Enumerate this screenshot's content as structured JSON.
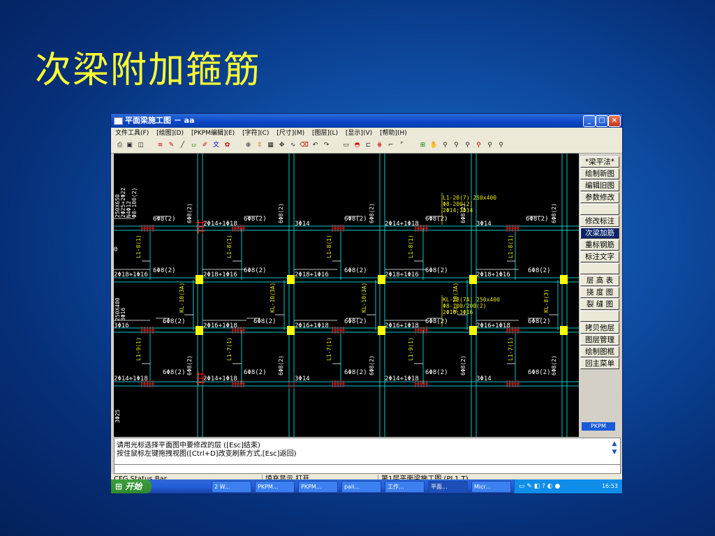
{
  "slide_title": "次梁附加箍筋",
  "window": {
    "title": "平面梁施工图 － aa",
    "min_label": "_",
    "max_label": "□",
    "close_label": "×"
  },
  "menu": [
    "文件工具(F)",
    "[绘图](D)",
    "[PKPM编辑](E)",
    "[字符](C)",
    "[尺寸](M)",
    "[图层](L)",
    "[显示](V)",
    "[帮助](H)"
  ],
  "side_menu": {
    "items": [
      "*梁平法*",
      "绘制新图",
      "编辑旧图",
      "参数修改",
      "",
      "修改标注",
      "次梁加筋",
      "重标钢筋",
      "标注文字",
      "",
      "层 高 表",
      "挠 度 图",
      "裂 缝 图",
      "",
      "拷贝他层",
      "图层管理",
      "绘制图框",
      "回主菜单"
    ],
    "selected_index": 6,
    "logo": "PKPM"
  },
  "command": {
    "line1": "请用光标选择平面图中要修改的层 ([Esc]结束)",
    "line2": "按住鼠标左键拖拽视图([Ctrl+D]改变刷新方式,[Esc]返回)"
  },
  "status": {
    "left": "CFG Status Bar",
    "mid": "填充显示 打开",
    "right": "第1层平面梁施工图 (PL1.T)"
  },
  "taskbar": {
    "start": "开始",
    "tasks": [
      "2 W...",
      "PKPM...",
      "PKPM...",
      "pali...",
      "工作...",
      "平面...",
      "Micr..."
    ],
    "active_index": 5,
    "clock": "16:53"
  },
  "drawing": {
    "labels": {
      "stirrup": "6Φ8(2)",
      "stirrup_v": "6Φ8(2)",
      "r1": "2Φ14+1Φ18",
      "r2": "3Φ14",
      "r3": "2Φ18+1Φ16",
      "r4": "2Φ16+1Φ18",
      "r5": "3Φ16",
      "r6": "2Φ16+1Φ18",
      "l8": "L1-8(1)",
      "l9": "L1-9(1)",
      "l7": "L1-7(1)",
      "kl10": "KL-10(3A)",
      "kl8": "KL-8(3)",
      "callout1_a": "L1-20(7) 250x400",
      "callout1_b": "Φ8-200(2)",
      "callout1_c": "2Φ14;3Φ14",
      "callout2_a": "KL-28(7A) 250x400",
      "callout2_b": "Φ8-100/200(2)",
      "callout2_c": "2Φ16;3Φ16",
      "left_a": "250X650",
      "left_b": "2Φ25+2Φ22",
      "left_c": "N4Φ12",
      "left_d": "Φ8-100(2)",
      "left_e": "250X400",
      "left_f": "3Φ16",
      "left_g": "3Φ25",
      "left_zero": "0"
    }
  }
}
